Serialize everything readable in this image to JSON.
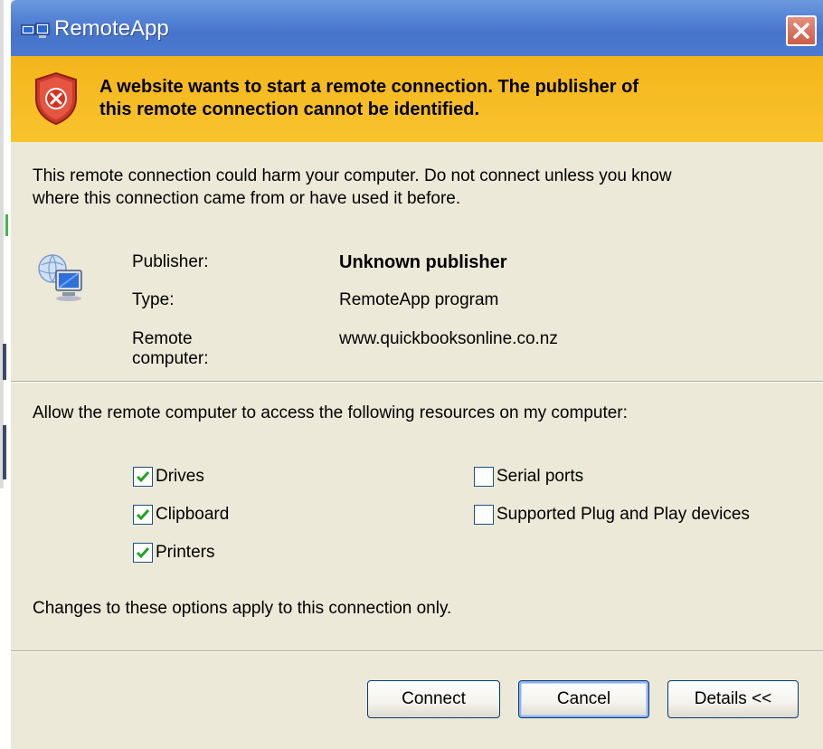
{
  "window": {
    "title": "RemoteApp",
    "close_label": "Close"
  },
  "warning": {
    "line1": "A website wants to start a remote connection. The publisher of",
    "line2": "this remote connection cannot be identified.",
    "icon": "shield-error-icon",
    "band_color": "#f7bd26"
  },
  "description": {
    "line1": "This remote connection could harm your computer. Do not connect unless you know",
    "line2": "where this connection came from or have used it before."
  },
  "info": {
    "publisher_label": "Publisher:",
    "publisher_value": "Unknown publisher",
    "type_label": "Type:",
    "type_value": "RemoteApp program",
    "remote_label": "Remote computer:",
    "remote_value": "www.quickbooksonline.co.nz"
  },
  "resources": {
    "heading": "Allow the remote computer to access the following resources on my computer:",
    "items": [
      {
        "label": "Drives",
        "checked": true
      },
      {
        "label": "Clipboard",
        "checked": true
      },
      {
        "label": "Printers",
        "checked": true
      },
      {
        "label": "Serial ports",
        "checked": false
      },
      {
        "label": "Supported Plug and Play devices",
        "checked": false
      }
    ],
    "footnote": "Changes to these options apply to this connection only."
  },
  "buttons": {
    "connect": "Connect",
    "cancel": "Cancel",
    "details": "Details <<"
  },
  "colors": {
    "titlebar": "#4d7ad0",
    "dialog_bg": "#ece9d8",
    "checkmark": "#21a121"
  }
}
